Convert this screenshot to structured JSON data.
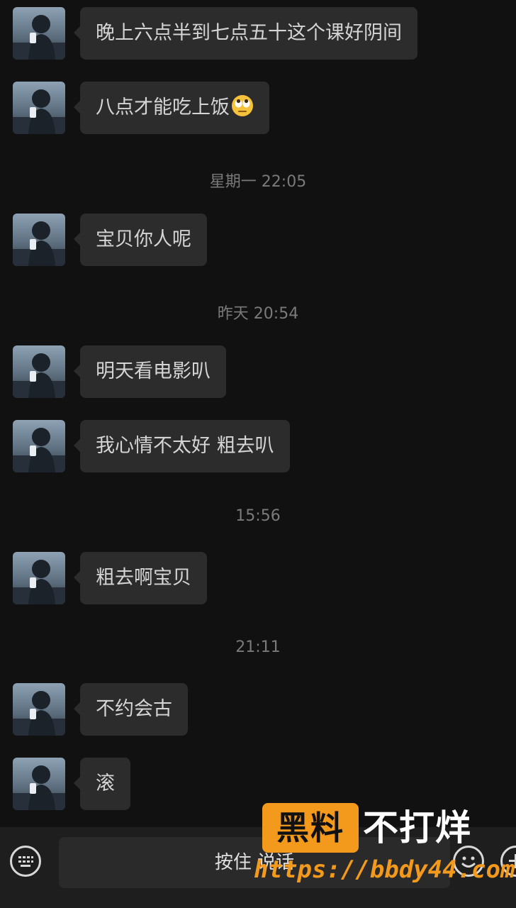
{
  "messages": [
    {
      "text": "晚上六点半到七点五十这个课好阴间",
      "emoji": ""
    },
    {
      "text": "八点才能吃上饭",
      "emoji": "eye-roll-emoji"
    },
    {
      "text": "宝贝你人呢",
      "emoji": ""
    },
    {
      "text": "明天看电影叭",
      "emoji": ""
    },
    {
      "text": "我心情不太好 粗去叭",
      "emoji": ""
    },
    {
      "text": "粗去啊宝贝",
      "emoji": ""
    },
    {
      "text": "不约会古",
      "emoji": ""
    },
    {
      "text": "滚",
      "emoji": ""
    }
  ],
  "timestamps": [
    "星期一 22:05",
    "昨天 20:54",
    "15:56",
    "21:11"
  ],
  "input_bar": {
    "talk_label": "按住 说话",
    "left_icon": "keyboard-icon",
    "right_icons": [
      "emoji-icon",
      "plus-icon"
    ]
  },
  "watermark": {
    "brand": "黑料",
    "brand_tail": "不打烊",
    "url": "https://bbdy44.com"
  },
  "colors": {
    "background": "#111111",
    "bubble": "#2c2c2c",
    "text": "#d5d5d5",
    "timestamp": "#7a7a7a",
    "watermark_accent": "#f39a1d"
  }
}
